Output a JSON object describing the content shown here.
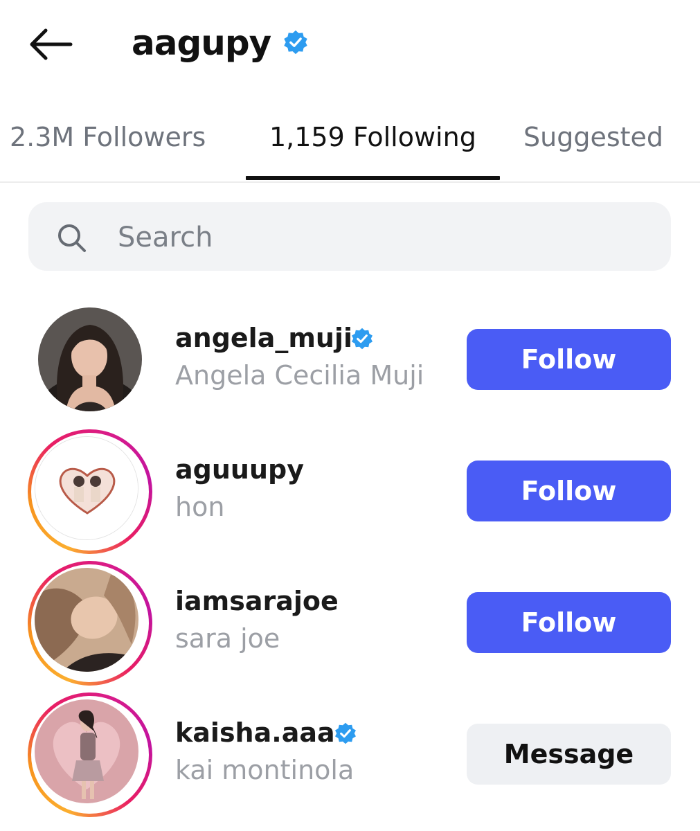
{
  "header": {
    "title": "aagupy",
    "back_icon": "arrow-left-icon",
    "verified": true
  },
  "tabs": [
    {
      "label": "2.3M Followers",
      "active": false
    },
    {
      "label": "1,159 Following",
      "active": true
    },
    {
      "label": "Suggested",
      "active": false
    }
  ],
  "search": {
    "placeholder": "Search",
    "value": "",
    "icon": "search-icon"
  },
  "accounts": [
    {
      "username": "angela_muji",
      "full_name": "Angela Cecilia Muji",
      "verified": true,
      "story_ring": false,
      "button": "Follow"
    },
    {
      "username": "aguuupy",
      "full_name": "hon",
      "verified": false,
      "story_ring": true,
      "button": "Follow"
    },
    {
      "username": "iamsarajoe",
      "full_name": "sara joe",
      "verified": false,
      "story_ring": true,
      "button": "Follow"
    },
    {
      "username": "kaisha.aaa",
      "full_name": "kai montinola",
      "verified": true,
      "story_ring": true,
      "button": "Message"
    }
  ],
  "colors": {
    "follow_button": "#4a5cf5",
    "verified_badge": "#2d9cf0",
    "message_button": "#eef0f3",
    "story_ring_start": "#fbae2f",
    "story_ring_end": "#d81b8a"
  }
}
